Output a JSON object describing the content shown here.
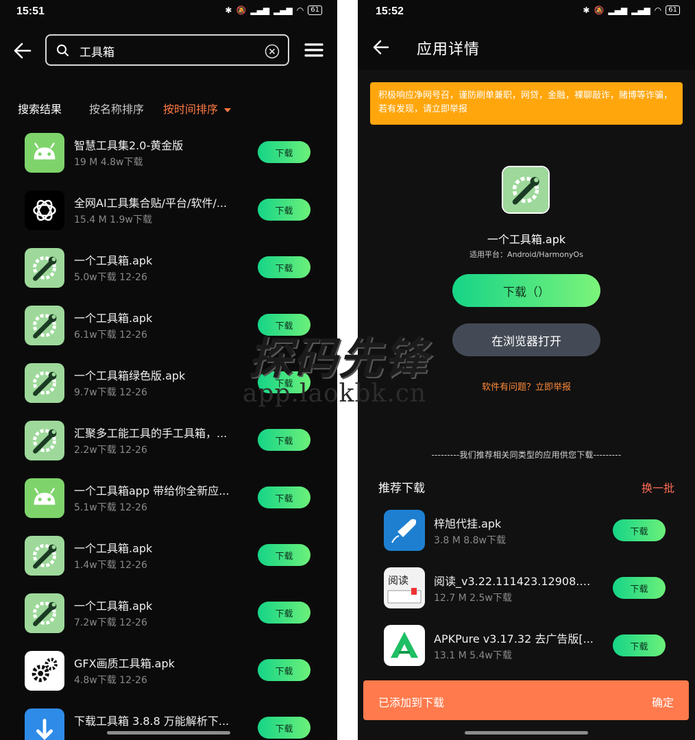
{
  "left": {
    "time": "15:51",
    "battery": "61",
    "search_value": "工具箱",
    "sort": {
      "results": "搜索结果",
      "by_name": "按名称排序",
      "by_time": "按时间排序"
    },
    "items": [
      {
        "title": "智慧工具集2.0-黄金版",
        "meta": "19 M  4.8w下载",
        "icon": "android-icon"
      },
      {
        "title": "全网AI工具集合贴/平台/软件/...",
        "meta": "15.4 M  1.9w下载",
        "icon": "openai-icon"
      },
      {
        "title": "一个工具箱.apk",
        "meta": "5.0w下载  12-26",
        "icon": "wrench-gear-icon"
      },
      {
        "title": "一个工具箱.apk",
        "meta": "6.1w下载  12-26",
        "icon": "wrench-gear-icon"
      },
      {
        "title": "一个工具箱绿色版.apk",
        "meta": "9.7w下载  12-26",
        "icon": "wrench-gear-icon"
      },
      {
        "title": "汇聚多工能工具的手工具箱，...",
        "meta": "2.2w下载  12-26",
        "icon": "wrench-gear-icon"
      },
      {
        "title": "一个工具箱app 带给你全新应...",
        "meta": "5.1w下载  12-26",
        "icon": "android-icon"
      },
      {
        "title": "一个工具箱.apk",
        "meta": "1.4w下载  12-26",
        "icon": "wrench-gear-icon"
      },
      {
        "title": "一个工具箱.apk",
        "meta": "7.2w下载  12-26",
        "icon": "wrench-gear-icon"
      },
      {
        "title": "GFX画质工具箱.apk",
        "meta": "4.8w下载  12-26",
        "icon": "gears-icon"
      },
      {
        "title": "下载工具箱 3.8.8 万能解析下...",
        "meta": "",
        "icon": "download-icon"
      }
    ],
    "download_label": "下载"
  },
  "right": {
    "time": "15:52",
    "battery": "61",
    "title": "应用详情",
    "warning": "积极响应净网号召，谨防刷单兼职，网贷，金融，裸聊敲诈，赌博等诈骗，若有发现，请立即举报",
    "app_name": "一个工具箱.apk",
    "platform": "适用平台：Android/HarmonyOs",
    "download_btn": "下载（）",
    "browser_btn": "在浏览器打开",
    "report": "软件有问题？立即举报",
    "rec_hint": "---------我们推荐相关同类型的应用供您下载---------",
    "rec_title": "推荐下载",
    "rec_more": "换一批",
    "rec_items": [
      {
        "title": "梓旭代挂.apk",
        "meta": "3.8 M  8.8w下载",
        "icon": "rocket-icon"
      },
      {
        "title": "阅读_v3.22.111423.12908.apk",
        "meta": "12.7 M  2.5w下载",
        "icon": "read-book-icon"
      },
      {
        "title": "APKPure v3.17.32 去广告版[...",
        "meta": "13.1 M  5.4w下载",
        "icon": "apkpure-icon"
      }
    ],
    "download_label": "下载",
    "toast": "已添加到下载",
    "toast_ok": "确定"
  },
  "watermark": {
    "main": "探码先锋",
    "sub": "app.laokbk.cn"
  },
  "colors": {
    "accent_green": "#16d487",
    "orange_warning": "#ffa60d",
    "link_orange": "#ff8a3b",
    "toast": "#ff7a4c",
    "android_green": "#7ed46b"
  }
}
